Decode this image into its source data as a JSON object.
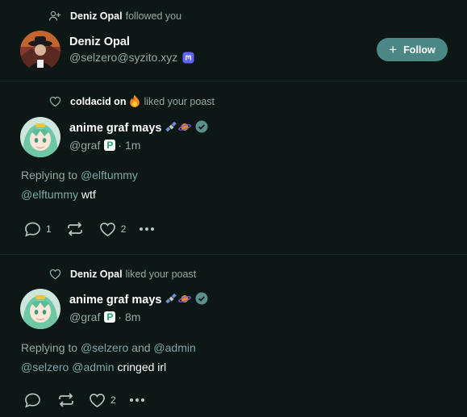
{
  "colors": {
    "background": "#0c1716",
    "accent": "#4b8784",
    "muted": "#93a7a4",
    "link": "#7aa7a2",
    "divider": "#1d2b29",
    "mastodon": "#6364ff",
    "verified": "#5b8f8b"
  },
  "notifications": [
    {
      "type": "follow",
      "icon": "user-plus-icon",
      "actor": "Deniz Opal",
      "verb": "followed you",
      "account": {
        "display_name": "Deniz Opal",
        "handle": "@selzero@syzito.xyz",
        "instance_icon": "mastodon-icon"
      },
      "follow_label": "Follow"
    },
    {
      "type": "like",
      "icon": "heart-icon",
      "actor": "coldacid on",
      "actor_emoji": "fire-emoji",
      "verb": "liked your poast",
      "post": {
        "display_name": "anime graf mays",
        "name_emojis": [
          "satellite-emoji",
          "ringed-planet-emoji"
        ],
        "handle": "@graf",
        "time": "1m",
        "replying_prefix": "Replying to",
        "replying_to": [
          "@elftummy"
        ],
        "mentions": [
          "@elftummy"
        ],
        "text": "wtf",
        "replies": "1",
        "likes": "2"
      }
    },
    {
      "type": "like",
      "icon": "heart-icon",
      "actor": "Deniz Opal",
      "verb": "liked your poast",
      "post": {
        "display_name": "anime graf mays",
        "name_emojis": [
          "satellite-emoji",
          "ringed-planet-emoji"
        ],
        "handle": "@graf",
        "time": "8m",
        "replying_prefix": "Replying to",
        "replying_to": [
          "@selzero",
          "@admin"
        ],
        "replying_joiner": "and",
        "mentions": [
          "@selzero",
          "@admin"
        ],
        "text": "cringed irl",
        "replies": "",
        "likes": "2"
      }
    }
  ],
  "separator": "·"
}
